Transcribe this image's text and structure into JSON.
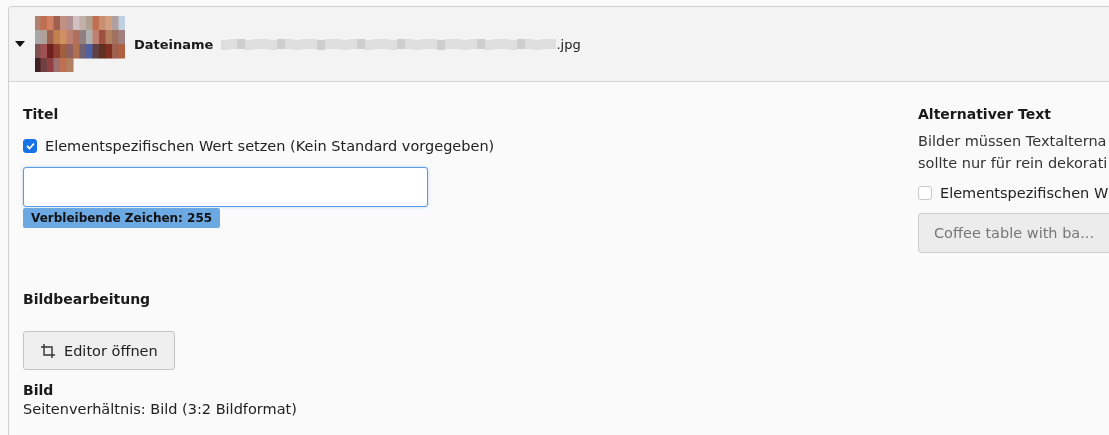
{
  "file_header": {
    "expanded": true,
    "label": "Dateiname",
    "filename_suffix": ".jpg"
  },
  "title_section": {
    "heading": "Titel",
    "override": {
      "label": "Elementspezifischen Wert setzen (Kein Standard vorgegeben)",
      "checked": true
    },
    "counter": "Verbleibende Zeichen: 255"
  },
  "image_editing": {
    "heading": "Bildbearbeitung",
    "button": "Editor öffnen"
  },
  "image": {
    "heading": "Bild",
    "aspect_ratio": "Seitenverhältnis: Bild (3:2 Bildformat)"
  },
  "alt_text": {
    "heading": "Alternativer Text",
    "description": [
      "Bilder müssen Textalterna",
      "sollte nur für rein dekorati"
    ],
    "override": {
      "label": "Elementspezifischen W",
      "checked": false
    },
    "field": {
      "value": "Coffee table with ba...",
      "disabled": true
    }
  }
}
